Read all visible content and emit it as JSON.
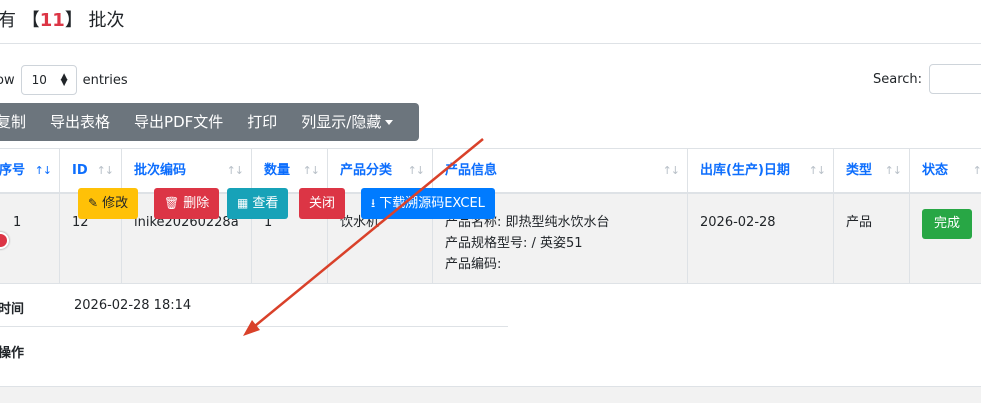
{
  "title": {
    "prefix": "有 ",
    "bracket_open": "【",
    "count": "11",
    "bracket_close": "】",
    "suffix": " 批次"
  },
  "length_menu": {
    "show": "ow",
    "value": "10",
    "entries": "entries"
  },
  "search": {
    "label": "Search:"
  },
  "button_group": [
    "复制",
    "导出表格",
    "导出PDF文件",
    "打印",
    "列显示/隐藏"
  ],
  "table": {
    "headers": [
      "序号",
      "ID",
      "批次编码",
      "数量",
      "产品分类",
      "产品信息",
      "出库(生产)日期",
      "类型",
      "状态"
    ],
    "row": {
      "index": "1",
      "id": "12",
      "batch_code": "inike20260228a",
      "quantity": "1",
      "category": "饮水机",
      "info": [
        "产品名称:  即热型纯水饮水台",
        "产品规格型号:  / 英姿51",
        "产品编码:"
      ],
      "date": "2026-02-28",
      "type": "产品",
      "status": "完成"
    }
  },
  "child_row": {
    "time_label": "时间",
    "time_value": "2026-02-28 18:14",
    "ops_label": "操作",
    "actions": [
      "修改",
      "删除",
      "查看",
      "关闭",
      "下载溯源码EXCEL"
    ]
  },
  "colors": {
    "edit": "#ffc107",
    "delete": "#dc3545",
    "view": "#17a2b8",
    "close": "#dc3545",
    "download": "#007bff",
    "status": "#28a745",
    "arrow": "#d9412a",
    "header_text": "#0d6efd"
  }
}
